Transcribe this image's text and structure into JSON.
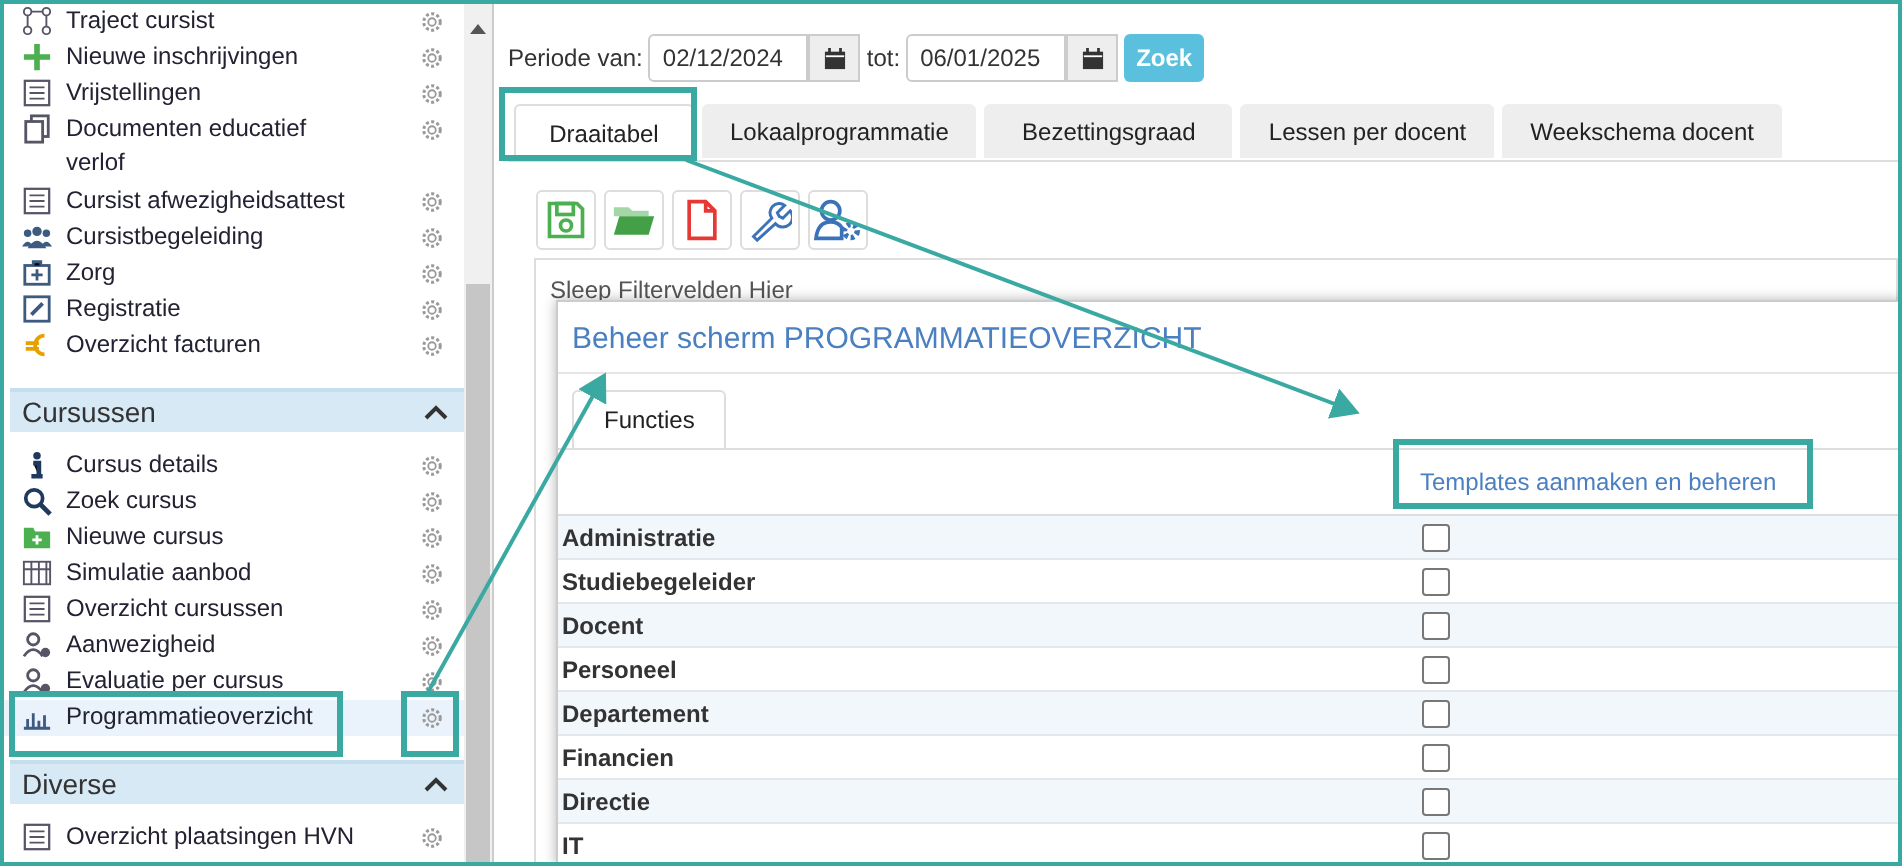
{
  "sidebar": {
    "groups": [
      {
        "items": [
          {
            "label": "Traject cursist",
            "selected": false
          },
          {
            "label": "Nieuwe inschrijvingen",
            "selected": false
          },
          {
            "label": "Vrijstellingen",
            "selected": false
          },
          {
            "label": "Documenten educatief verlof",
            "selected": false
          },
          {
            "label": "Cursist afwezigheidsattest",
            "selected": false
          },
          {
            "label": "Cursistbegeleiding",
            "selected": false
          },
          {
            "label": "Zorg",
            "selected": false
          },
          {
            "label": "Registratie",
            "selected": false
          },
          {
            "label": "Overzicht facturen",
            "selected": false
          }
        ]
      },
      {
        "title": "Cursussen",
        "expanded": true,
        "items": [
          {
            "label": "Cursus details",
            "selected": false
          },
          {
            "label": "Zoek cursus",
            "selected": false
          },
          {
            "label": "Nieuwe cursus",
            "selected": false
          },
          {
            "label": "Simulatie aanbod",
            "selected": false
          },
          {
            "label": "Overzicht cursussen",
            "selected": false
          },
          {
            "label": "Aanwezigheid",
            "selected": false
          },
          {
            "label": "Evaluatie per cursus",
            "selected": false
          },
          {
            "label": "Programmatieoverzicht",
            "selected": true
          }
        ]
      },
      {
        "title": "Diverse",
        "expanded": true,
        "items": [
          {
            "label": "Overzicht plaatsingen HVN",
            "selected": false
          }
        ]
      }
    ]
  },
  "filter": {
    "from_label": "Periode van:",
    "from_value": "02/12/2024",
    "to_label": "tot:",
    "to_value": "06/01/2025",
    "button": "Zoek"
  },
  "tabs": [
    {
      "label": "Draaitabel",
      "selected": true
    },
    {
      "label": "Lokaalprogrammatie",
      "selected": false
    },
    {
      "label": "Bezettingsgraad",
      "selected": false
    },
    {
      "label": "Lessen per docent",
      "selected": false
    },
    {
      "label": "Weekschema docent",
      "selected": false
    }
  ],
  "drop_zone": "Sleep Filtervelden Hier",
  "dialog": {
    "title": "Beheer scherm PROGRAMMATIEOVERZICHT",
    "tabs": [
      {
        "label": "Functies",
        "selected": true
      }
    ],
    "column_header": "Templates aanmaken en beheren",
    "rows": [
      {
        "name": "Administratie",
        "checked": false
      },
      {
        "name": "Studiebegeleider",
        "checked": false
      },
      {
        "name": "Docent",
        "checked": false
      },
      {
        "name": "Personeel",
        "checked": false
      },
      {
        "name": "Departement",
        "checked": false
      },
      {
        "name": "Financien",
        "checked": false
      },
      {
        "name": "Directie",
        "checked": false
      },
      {
        "name": "IT",
        "checked": false
      }
    ]
  }
}
